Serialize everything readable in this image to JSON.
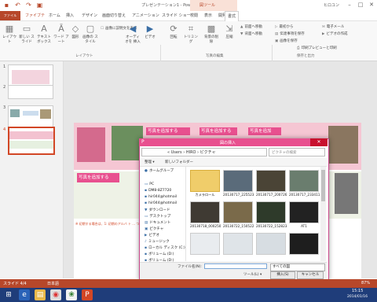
{
  "app": {
    "title": "プレゼンテーション1 - PowerPoint",
    "context_tab_group": "図ツール",
    "user": "ヒロユン",
    "qat": [
      "save-icon",
      "undo-icon",
      "redo-icon",
      "slideshow-icon"
    ]
  },
  "tabs": [
    "ファイル",
    "ファイブテ",
    "ホーム",
    "挿入",
    "デザイン",
    "画面切り替え",
    "アニメーション",
    "スライド ショー",
    "校閲",
    "表示",
    "開発",
    "書式"
  ],
  "ribbon": {
    "buttons": [
      {
        "label": "レイアウト"
      },
      {
        "label": "新しい スライド"
      },
      {
        "label": "テキスト ボックス"
      },
      {
        "label": "ワード アート"
      },
      {
        "label": "図形"
      },
      {
        "label": "画像の スタイル"
      },
      {
        "label": "オーディオを 挿入"
      },
      {
        "label": "ビデオ"
      },
      {
        "label": "回転"
      },
      {
        "label": "トリミング"
      },
      {
        "label": "背景の削除"
      },
      {
        "label": "圧縮"
      }
    ],
    "small": {
      "caption": "画像に説明文を表示",
      "order1": "前面へ移動",
      "order2": "背面へ移動",
      "move1": "最初から",
      "move2": "伝達事項を保存",
      "move3": "画像を保存",
      "media1": "電子メール",
      "media2": "ビデオの作成",
      "media3": "印刷プレビューと印刷"
    },
    "groups": [
      "レイアウト",
      "写真の編集",
      "保存と出力"
    ]
  },
  "slides": {
    "numbers": [
      "1",
      "2",
      "3",
      "4"
    ],
    "selected": "4",
    "main_titles": [
      "写真を追加する",
      "写真を追加する",
      "写真を追加",
      "写真を追加する"
    ],
    "footer_text": "※ 初期する場合は、1: 初期のアルバ ト ... つの設定を追加する"
  },
  "dialog": {
    "title": "図の挿入",
    "path": "« Users › HIRO › ピクチャ",
    "search_placeholder": "ピクチャの検索",
    "toolbar_organize": "整理 ▾",
    "toolbar_new_folder": "新しいフォルダー",
    "nav": [
      "ホームグループ",
      "PC",
      "DM8-8Z7720",
      "hir044@hotmail",
      "hir044@hotmail",
      "ダウンロード",
      "デスクトップ",
      "ドキュメント",
      "ピクチャ",
      "ビデオ",
      "ミュージック",
      "ローカル ディスク (C:)",
      "ボリューム (D:)",
      "ボリューム (D:)"
    ],
    "files": [
      {
        "name": "カメラロール",
        "kind": "folder"
      },
      {
        "name": "20130717_225523",
        "kind": "photo"
      },
      {
        "name": "20130717_200726",
        "kind": "photo"
      },
      {
        "name": "20130717_233411",
        "kind": "photo"
      },
      {
        "name": "20130718_000250",
        "kind": "photo"
      },
      {
        "name": "20130722_150522",
        "kind": "photo"
      },
      {
        "name": "20130722_152823",
        "kind": "photo"
      },
      {
        "name": "AT1",
        "kind": "photo"
      },
      {
        "name": "",
        "kind": "photo"
      },
      {
        "name": "",
        "kind": "photo"
      },
      {
        "name": "",
        "kind": "photo"
      },
      {
        "name": "",
        "kind": "photo"
      }
    ],
    "filename_label": "ファイル名(N):",
    "filename_value": "",
    "filetype": "すべての図",
    "tools": "ツール(L) ▾",
    "insert": "挿入(S)",
    "cancel": "キャンセル"
  },
  "status": {
    "slide": "スライド 4/4",
    "language": "日本語",
    "zoom": "87%"
  },
  "taskbar": {
    "time": "15:15",
    "date": "2014/01/16"
  },
  "colors": {
    "accent": "#b7472a",
    "dialog": "#e8508f",
    "taskbar": "#1f3d7a"
  }
}
